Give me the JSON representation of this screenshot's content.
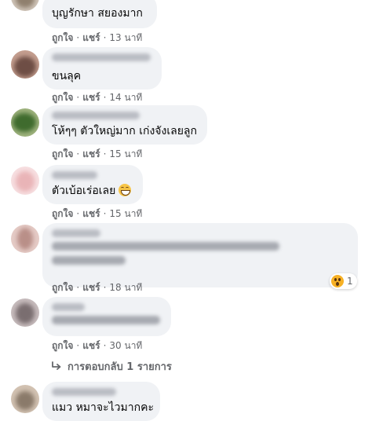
{
  "comments": [
    {
      "text": "บุญรักษา สยองมาก",
      "like": "ถูกใจ",
      "reply": "แชร์",
      "time": "13 นาที",
      "avatar_colors": [
        "#8f7f6d",
        "#cfc4b8"
      ]
    },
    {
      "text": "ขนลุค",
      "like": "ถูกใจ",
      "reply": "แชร์",
      "time": "14 นาที",
      "avatar_colors": [
        "#6e4e45",
        "#c49e8f"
      ]
    },
    {
      "text": "โห้ๆๆ ตัวใหญ่มาก เก่งจังเลยลูก",
      "like": "ถูกใจ",
      "reply": "แชร์",
      "time": "15 นาที",
      "avatar_colors": [
        "#3f6b2e",
        "#9fb37e"
      ]
    },
    {
      "text": "ตัวเบ้อเร่อเลย",
      "emoji": "grinning-face-emoji",
      "like": "ถูกใจ",
      "reply": "แชร์",
      "time": "15 นาที",
      "avatar_colors": [
        "#e9b4b7",
        "#f7dfe1"
      ]
    },
    {
      "text": "",
      "like": "ถูกใจ",
      "reply": "แชร์",
      "time": "18 นาที",
      "reaction": {
        "icon": "wow-reaction-icon",
        "count": "1"
      },
      "avatar_colors": [
        "#b98f88",
        "#e5cbc6"
      ]
    },
    {
      "text": "",
      "like": "ถูกใจ",
      "reply": "แชร์",
      "time": "30 นาที",
      "avatar_colors": [
        "#7a6e70",
        "#c7bcbd"
      ]
    },
    {
      "text": "แมว หมาจะไวมากคะ",
      "avatar_colors": [
        "#8a7a6a",
        "#d2c2b2"
      ]
    }
  ],
  "replies_link": {
    "icon": "reply-arrow-icon",
    "label": "การตอบกลับ 1 รายการ"
  },
  "separator": "·"
}
